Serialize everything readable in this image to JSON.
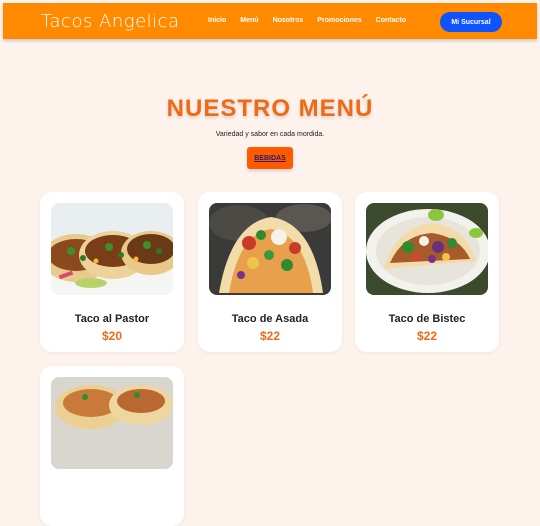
{
  "navbar": {
    "brand": "Tacos Angelica",
    "links": [
      "Inicio",
      "Menú",
      "Nosotros",
      "Promociones",
      "Contacto"
    ],
    "branch_button": "Mi Sucursal"
  },
  "menu": {
    "title": "NUESTRO MENÚ",
    "subtitle": "Variedad y sabor en cada mordida.",
    "drinks_button": "BEBIDAS"
  },
  "items": [
    {
      "name": "Taco al Pastor",
      "price": "$20"
    },
    {
      "name": "Taco de Asada",
      "price": "$22"
    },
    {
      "name": "Taco de Bistec",
      "price": "$22"
    }
  ],
  "colors": {
    "navbar": "#ff8a00",
    "accent": "#f06a16",
    "branch_button": "#0f53ff",
    "page_background": "#fdf3ec"
  }
}
